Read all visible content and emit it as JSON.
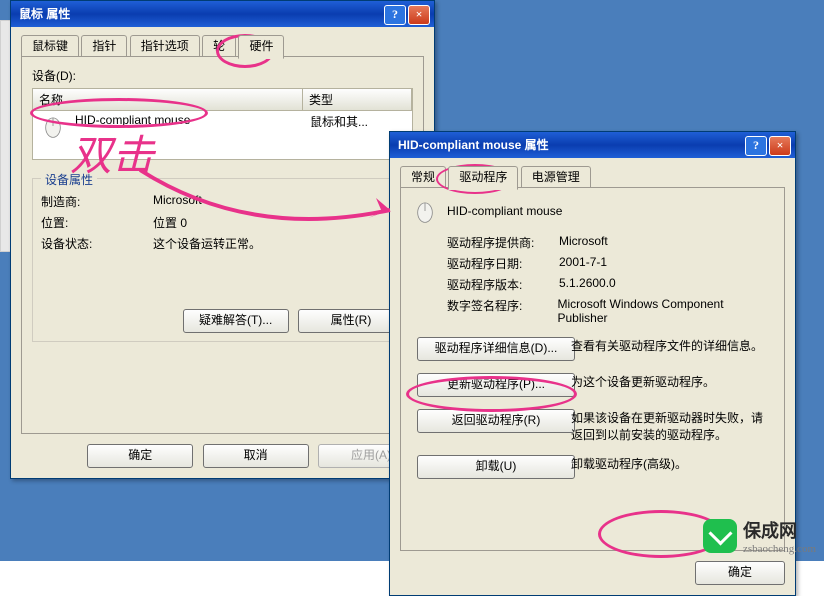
{
  "dlg1": {
    "title": "鼠标 属性",
    "tabs": [
      "鼠标键",
      "指针",
      "指针选项",
      "轮",
      "硬件"
    ],
    "devices_label": "设备(D):",
    "col_name": "名称",
    "col_type": "类型",
    "dev_name": "HID-compliant mouse",
    "dev_type": "鼠标和其...",
    "props_legend": "设备属性",
    "maker_label": "制造商:",
    "maker_value": "Microsoft",
    "loc_label": "位置:",
    "loc_value": "位置 0",
    "status_label": "设备状态:",
    "status_value": "这个设备运转正常。",
    "troubleshoot": "疑难解答(T)...",
    "properties": "属性(R)",
    "ok": "确定",
    "cancel": "取消",
    "apply": "应用(A)"
  },
  "dlg2": {
    "title": "HID-compliant mouse 属性",
    "tabs": [
      "常规",
      "驱动程序",
      "电源管理"
    ],
    "dev_name": "HID-compliant mouse",
    "provider_k": "驱动程序提供商:",
    "provider_v": "Microsoft",
    "date_k": "驱动程序日期:",
    "date_v": "2001-7-1",
    "ver_k": "驱动程序版本:",
    "ver_v": "5.1.2600.0",
    "signer_k": "数字签名程序:",
    "signer_v": "Microsoft Windows Component Publisher",
    "btn_details": "驱动程序详细信息(D)...",
    "btn_details_t": "查看有关驱动程序文件的详细信息。",
    "btn_update": "更新驱动程序(P)...",
    "btn_update_t": "为这个设备更新驱动程序。",
    "btn_rollback": "返回驱动程序(R)",
    "btn_rollback_t": "如果该设备在更新驱动器时失败，请返回到以前安装的驱动程序。",
    "btn_uninstall": "卸载(U)",
    "btn_uninstall_t": "卸载驱动程序(高级)。",
    "ok": "确定"
  },
  "anno": {
    "dblclick": "双击"
  },
  "watermark": {
    "name": "保成网",
    "url": "zsbaocheng.com"
  }
}
